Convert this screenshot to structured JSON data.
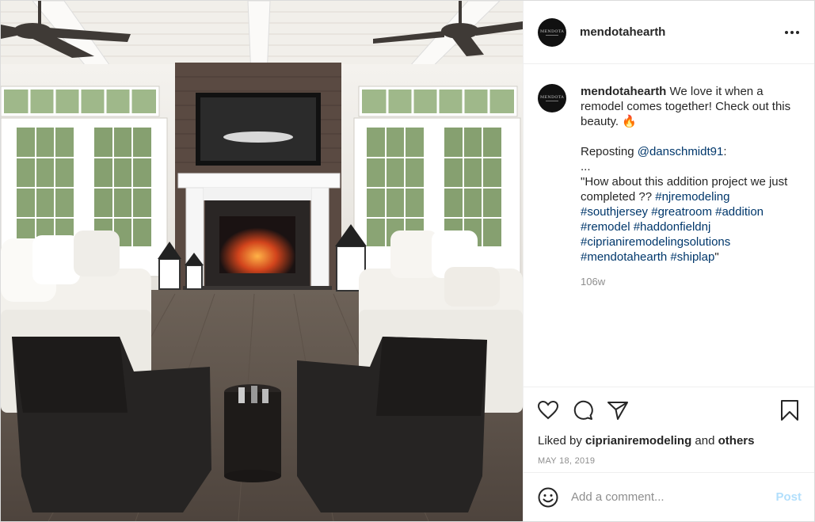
{
  "post": {
    "username": "mendotahearth",
    "avatar_text": "MENDOTA",
    "caption": {
      "username": "mendotahearth",
      "line1": " We love it when a remodel comes together! Check out this beauty. 🔥",
      "reposting_prefix": "Reposting ",
      "reposting_handle": "@danschmidt91",
      "reposting_suffix": ":",
      "ellipsis": "...",
      "quote_text": "\"How about this addition project we just completed ?? ",
      "hashtags": [
        "#njremodeling",
        "#southjersey",
        "#greatroom",
        "#addition",
        "#remodel",
        "#haddonfieldnj",
        "#ciprianiremodelingsolutions",
        "#mendotahearth",
        "#shiplap"
      ],
      "quote_end": "\""
    },
    "time_ago": "106w",
    "liked_by_prefix": "Liked by ",
    "liked_by_user": "ciprianiremodeling",
    "liked_by_and": " and ",
    "liked_by_others": "others",
    "date": "MAY 18, 2019",
    "comment_placeholder": "Add a comment...",
    "post_button": "Post"
  },
  "icons": {
    "more": "more-options-icon",
    "like": "heart-icon",
    "comment": "comment-bubble-icon",
    "share": "paper-plane-icon",
    "save": "bookmark-icon",
    "emoji": "smiley-icon"
  },
  "colors": {
    "link": "#00376b",
    "muted": "#8e8e8e",
    "post_button_disabled": "#b2dffc",
    "text": "#262626"
  }
}
